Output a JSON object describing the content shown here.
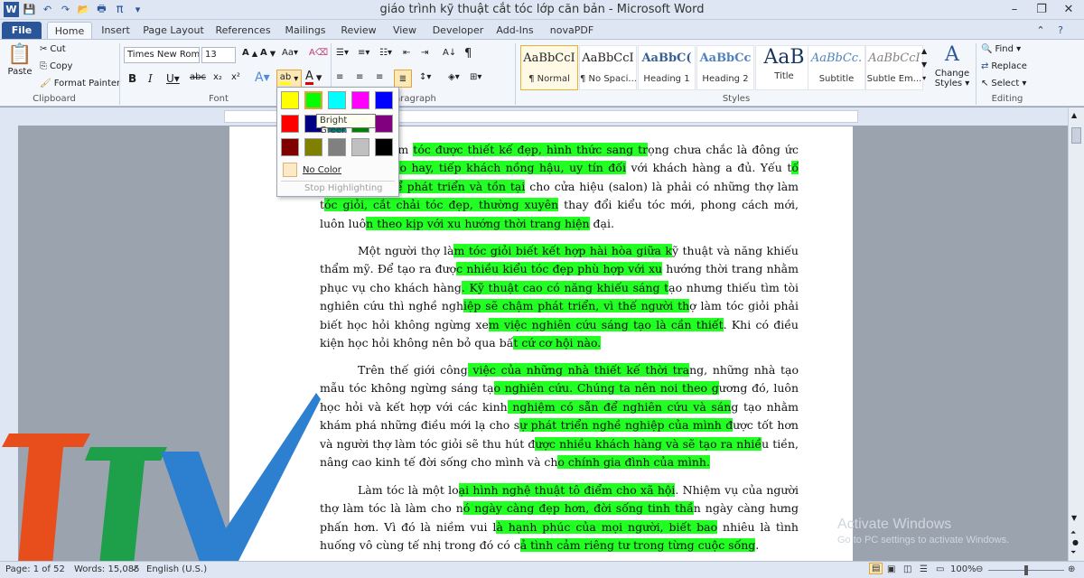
{
  "window": {
    "title": "giáo trình kỹ thuật cắt tóc lớp căn bản  -  Microsoft Word",
    "tabs": [
      "File",
      "Home",
      "Insert",
      "Page Layout",
      "References",
      "Mailings",
      "Review",
      "View",
      "Developer",
      "Add-Ins",
      "novaPDF"
    ]
  },
  "ribbon": {
    "clipboard": {
      "paste": "Paste",
      "cut": "Cut",
      "copy": "Copy",
      "format_painter": "Format Painter",
      "label": "Clipboard"
    },
    "font": {
      "name": "Times New Rom",
      "size": "13",
      "label": "Font"
    },
    "paragraph": {
      "label": "aragraph"
    },
    "styles": {
      "label": "Styles",
      "items": [
        {
          "preview": "AaBbCcI",
          "name": "¶ Normal"
        },
        {
          "preview": "AaBbCcI",
          "name": "¶ No Spaci..."
        },
        {
          "preview": "AaBbC(",
          "name": "Heading 1"
        },
        {
          "preview": "AaBbCc",
          "name": "Heading 2"
        },
        {
          "preview": "AaB",
          "name": "Title"
        },
        {
          "preview": "AaBbCc.",
          "name": "Subtitle"
        },
        {
          "preview": "AaBbCcI",
          "name": "Subtle Em..."
        }
      ],
      "change_styles": "Change Styles ▾"
    },
    "editing": {
      "find": "Find ▾",
      "replace": "Replace",
      "select": "Select ▾",
      "label": "Editing"
    }
  },
  "highlight_menu": {
    "colors": [
      "#ffff00",
      "#00ff00",
      "#00ffff",
      "#ff00ff",
      "#0000ff",
      "#ff0000",
      "#000080",
      "#008080",
      "#008000",
      "#800080",
      "#800000",
      "#808000",
      "#808080",
      "#c0c0c0",
      "#000000"
    ],
    "tooltip": "Bright Green",
    "no_color": "No Color",
    "stop": "Stop Highlighting"
  },
  "document": {
    "paragraphs": [
      [
        [
          "a hiệu làm ",
          false
        ],
        [
          "tóc được thiết kế đẹp, hình thức sang tr",
          true
        ],
        [
          "ọng chưa chắc là đông ",
          false
        ],
        [
          "ức đẹp qu",
          false
        ],
        [
          "ảng cáo hay, tiếp khách nồng hậu, uy tín đối",
          true
        ],
        [
          " với khách hàng ",
          false
        ],
        [
          "a đủ. Yếu t",
          false
        ],
        [
          "ố quan trọng để phát triển và tồn tại",
          true
        ],
        [
          " cho cửa hiệu (salon) là phải có những thợ làm t",
          false
        ],
        [
          "óc giỏi, cắt chải tóc đẹp, thường xuyên",
          true
        ],
        [
          " thay đổi kiểu tóc mới, phong cách mới, luôn luô",
          false
        ],
        [
          "n theo kịp với xu hướng thời trang hiện",
          true
        ],
        [
          " đại.",
          false
        ]
      ],
      [
        [
          "Một người thợ là",
          false
        ],
        [
          "m tóc giỏi biết kết hợp hài hòa giữa k",
          true
        ],
        [
          "ỹ thuật và năng khiếu thẩm mỹ. Để tạo ra đượ",
          false
        ],
        [
          "c nhiều kiểu tóc đẹp phù hợp với xu",
          true
        ],
        [
          " hướng thời trang nhằm phục vụ cho khách hàng",
          false
        ],
        [
          ". Kỹ thuật cao có năng khiếu sáng t",
          true
        ],
        [
          "ạo nhưng thiếu tìm tòi nghiên cứu thì nghề ngh",
          false
        ],
        [
          "iệp sẽ chậm phát triển, vì thế người th",
          true
        ],
        [
          "ợ làm tóc giỏi phải biết học hỏi không ngừng xe",
          false
        ],
        [
          "m việc nghiên cứu sáng tạo là cần thiết",
          true
        ],
        [
          ". Khi có điều kiện học hỏi không nên bỏ qua bấ",
          false
        ],
        [
          "t cứ cơ hội nào.",
          true
        ]
      ],
      [
        [
          "Trên thế giới công",
          false
        ],
        [
          " việc của những nhà thiết kế thời tra",
          true
        ],
        [
          "ng, những nhà tạo mẫu tóc không ngừng sáng tạ",
          false
        ],
        [
          "o nghiên cứu. Chúng ta nên noi theo g",
          true
        ],
        [
          "ương đó, luôn học hỏi và kết hợp với các kinh",
          false
        ],
        [
          " nghiệm có sẵn để nghiên cứu và sán",
          true
        ],
        [
          "g tạo nhằm khám phá những điều mới lạ cho s",
          false
        ],
        [
          "ự phát triển nghề nghiệp của mình đ",
          true
        ],
        [
          "ược tốt hơn và người thợ làm tóc giỏi sẽ thu hút đ",
          false
        ],
        [
          "ược nhiều khách hàng và sẽ tạo ra nhiề",
          true
        ],
        [
          "u tiền, nâng cao kinh tế đời sống cho mình và ch",
          false
        ],
        [
          "o chính gia đình của mình.",
          true
        ]
      ],
      [
        [
          "Làm tóc là một lo",
          false
        ],
        [
          "ại hình nghệ thuật tô điểm cho xã hội",
          true
        ],
        [
          ". Nhiệm vụ của người thợ làm tóc là làm cho n",
          false
        ],
        [
          "ó ngày càng đẹp hơn, đời sống tinh thầ",
          true
        ],
        [
          "n ngày càng hưng phấn hơn. Vì đó là niềm vui l",
          false
        ],
        [
          "à hạnh phúc của mọi người, biết bao",
          true
        ],
        [
          " nhiêu là tình huống vô cùng tế nhị trong đó có c",
          false
        ],
        [
          "ả tình cảm riêng tư trong từng cuộc sống",
          true
        ],
        [
          ".",
          false
        ]
      ]
    ]
  },
  "status": {
    "page": "Page: 1 of 52",
    "words": "Words: 15,085",
    "lang": "English (U.S.)",
    "zoom": "100%"
  },
  "watermark": {
    "line1": "Activate Windows",
    "line2": "Go to PC settings to activate Windows."
  }
}
